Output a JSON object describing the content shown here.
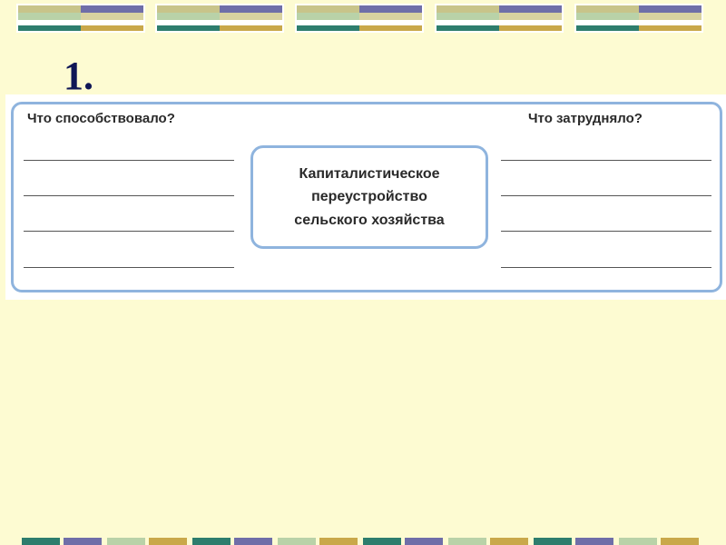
{
  "slide": {
    "number": "1."
  },
  "worksheet": {
    "left_heading": "Что способствовало?",
    "right_heading": "Что затрудняло?",
    "center_text": "Капиталистическое\nпереустройство\nсельского хозяйства",
    "left_lines": 4,
    "right_lines": 4
  },
  "colors": {
    "background": "#fdfbd2",
    "number_color": "#0f1656",
    "frame_color": "#8fb4de",
    "stripe_olive": "#c8c48a",
    "stripe_purple": "#6f6ea8",
    "stripe_sage": "#b9d2a8",
    "stripe_teal": "#2d7d6d",
    "stripe_gold": "#c9a84a"
  }
}
